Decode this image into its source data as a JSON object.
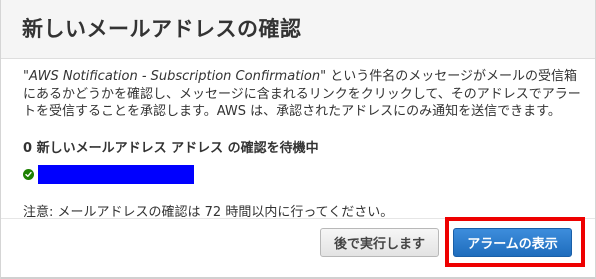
{
  "dialog": {
    "title": "新しいメールアドレスの確認",
    "description_quote": "\"AWS Notification - Subscription Confirmation\"",
    "description_rest": " という件名のメッセージがメールの受信箱にあるかどうかを確認し、メッセージに含まれるリンクをクリックして、そのアドレスでアラートを受信することを承認します。AWS は、承認されたアドレスにのみ通知を送信できます。",
    "pending_text": "0 新しいメールアドレス アドレス の確認を待機中",
    "email_status_icon": "check-circle-icon",
    "email_value_redacted": true,
    "note": "注意: メールアドレスの確認は 72 時間以内に行ってください。",
    "buttons": {
      "later_label": "後で実行します",
      "view_alarms_label": "アラームの表示"
    },
    "colors": {
      "primary_button": "#2d7fd0",
      "check_icon": "#1d8102",
      "redaction": "#0000ff",
      "highlight": "#ee0000"
    }
  }
}
